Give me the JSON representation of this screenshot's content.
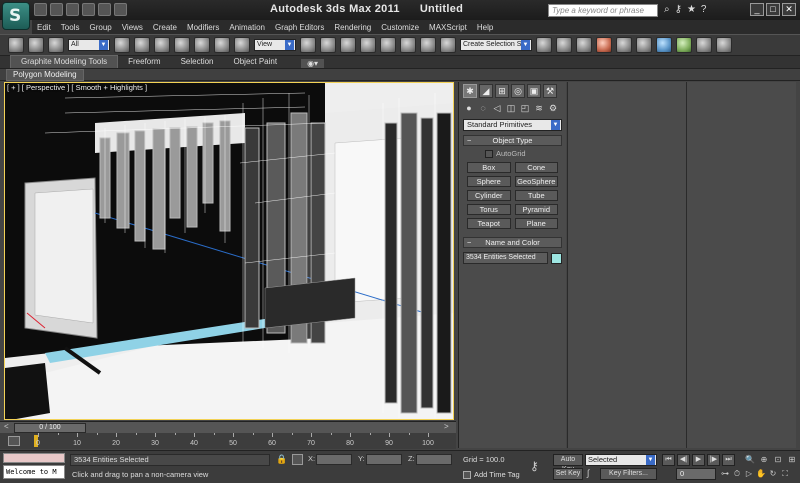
{
  "title": {
    "app": "Autodesk 3ds Max  2011",
    "doc": "Untitled",
    "search_placeholder": "Type a keyword or phrase"
  },
  "menu": [
    "Edit",
    "Tools",
    "Group",
    "Views",
    "Create",
    "Modifiers",
    "Animation",
    "Graph Editors",
    "Rendering",
    "Customize",
    "MAXScript",
    "Help"
  ],
  "toolbar": {
    "filter_value": "All",
    "ref_coord_value": "View",
    "selection_set_placeholder": "Create Selection Se"
  },
  "ribbon": {
    "tabs": [
      "Graphite Modeling Tools",
      "Freeform",
      "Selection",
      "Object Paint"
    ],
    "active_panel": "Polygon Modeling"
  },
  "viewport": {
    "label": "[ + ] [ Perspective ] [ Smooth + Highlights ]"
  },
  "command_panel": {
    "category": "Standard Primitives",
    "object_type_title": "Object Type",
    "autogrid": "AutoGrid",
    "buttons": [
      "Box",
      "Cone",
      "Sphere",
      "GeoSphere",
      "Cylinder",
      "Tube",
      "Torus",
      "Pyramid",
      "Teapot",
      "Plane"
    ],
    "name_color_title": "Name and Color",
    "name_value": "3534 Entities Selected",
    "object_color": "#9de6e2"
  },
  "timeline": {
    "slider_label": "0 / 100",
    "ticks": [
      "0",
      "10",
      "20",
      "30",
      "40",
      "50",
      "60",
      "70",
      "80",
      "90",
      "100"
    ]
  },
  "status": {
    "selection": "3534 Entities Selected",
    "prompt": "Click and drag to pan a non-camera view",
    "x_label": "X:",
    "y_label": "Y:",
    "z_label": "Z:",
    "grid": "Grid = 100.0",
    "add_time_tag": "Add Time Tag",
    "auto_key": "Auto Key",
    "set_key": "Set Key",
    "key_mode": "Selected",
    "key_filters": "Key Filters...",
    "frame": "0",
    "listener": "Welcome to M"
  }
}
